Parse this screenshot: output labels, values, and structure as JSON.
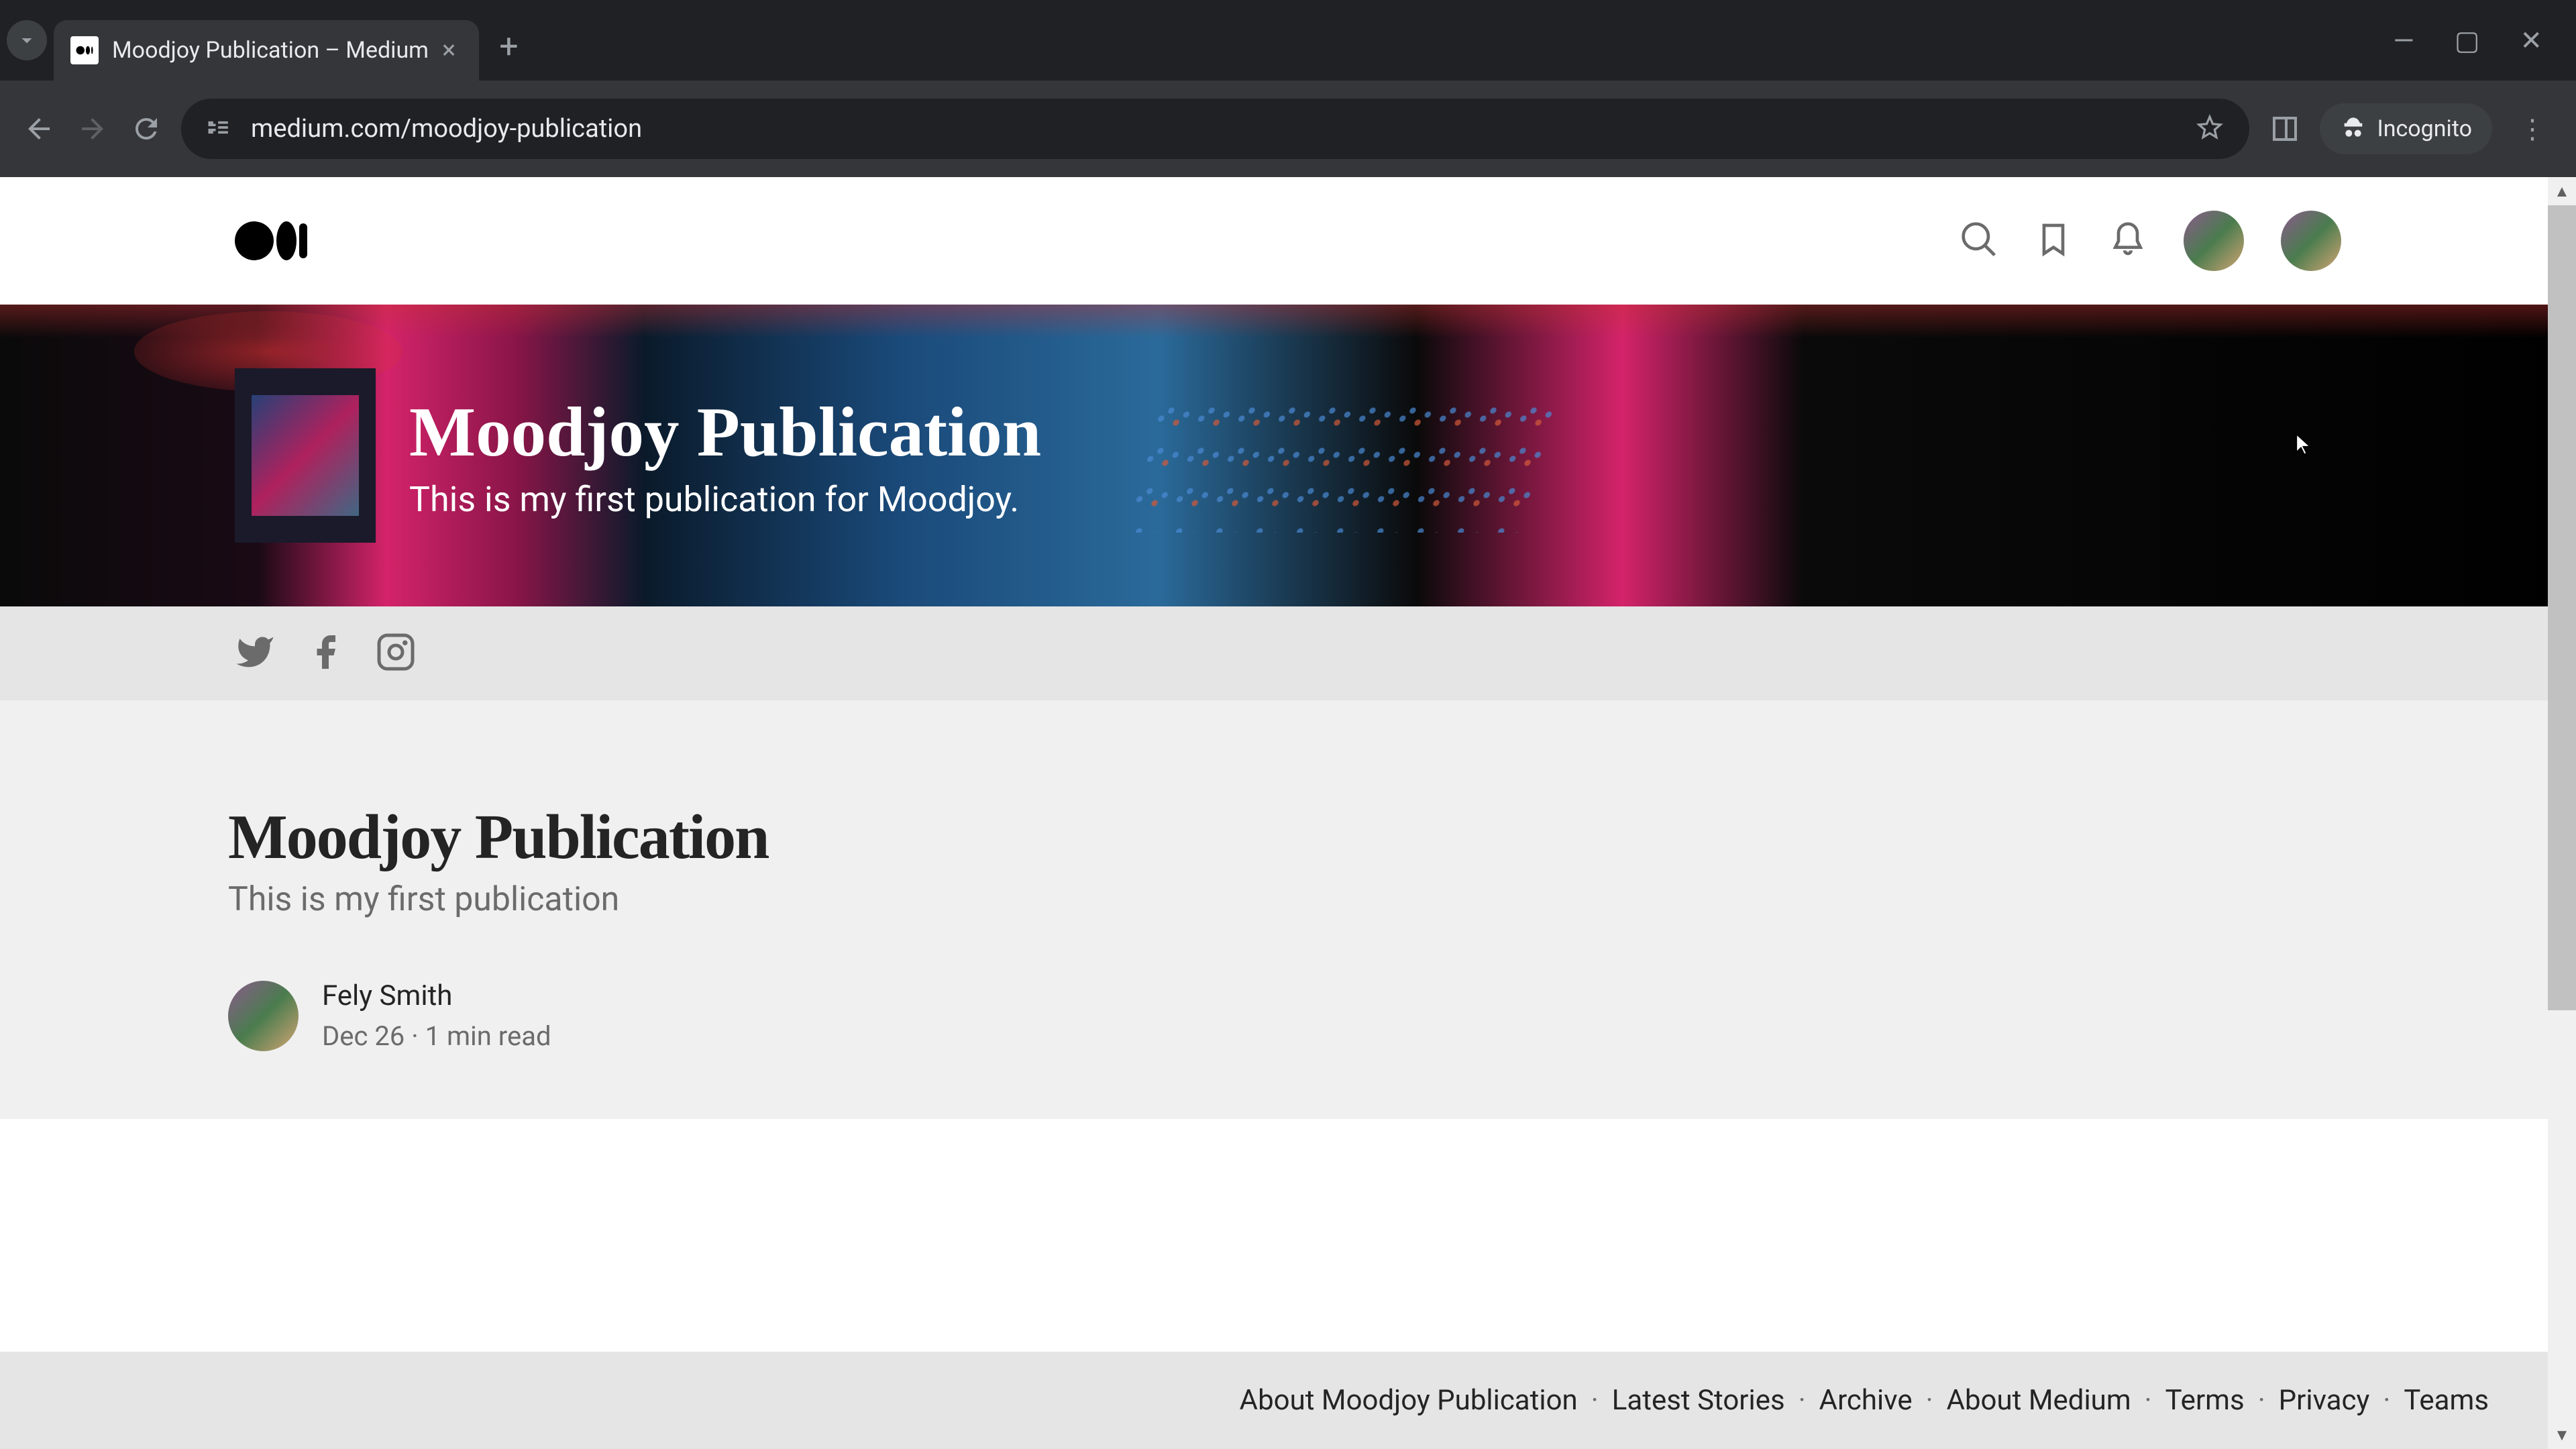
{
  "browser": {
    "tab_title": "Moodjoy Publication – Medium",
    "url": "medium.com/moodjoy-publication",
    "incognito_label": "Incognito"
  },
  "header": {
    "icons": {
      "search": "search-icon",
      "bookmark": "bookmark-icon",
      "notifications": "bell-icon"
    }
  },
  "hero": {
    "title": "Moodjoy Publication",
    "subtitle": "This is my first publication for Moodjoy."
  },
  "article": {
    "title": "Moodjoy Publication",
    "subtitle": "This is my first publication",
    "author": "Fely Smith",
    "date": "Dec 26",
    "read_time": "1 min read"
  },
  "footer": {
    "links": [
      "About Moodjoy Publication",
      "Latest Stories",
      "Archive",
      "About Medium",
      "Terms",
      "Privacy",
      "Teams"
    ]
  }
}
